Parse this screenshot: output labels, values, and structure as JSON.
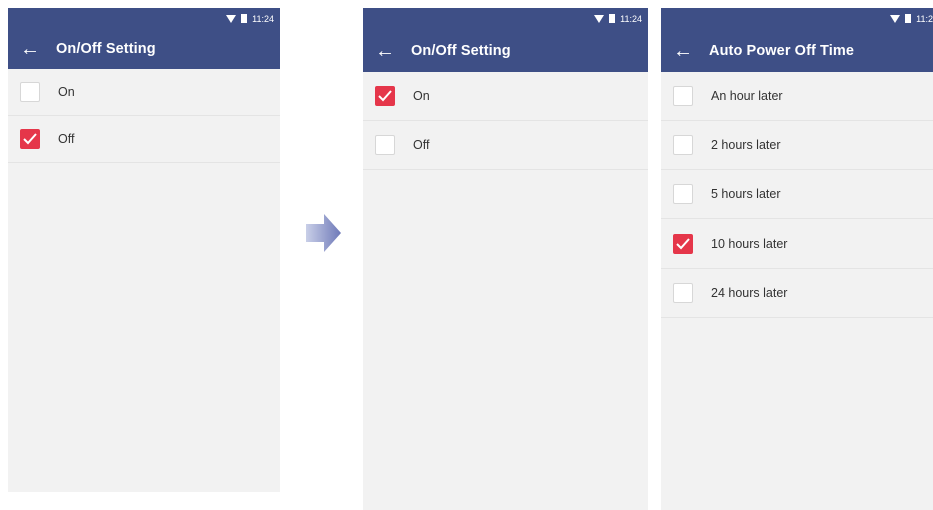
{
  "status": {
    "time": "11:24",
    "time_clipped": "11:2"
  },
  "screens": [
    {
      "title": "On/Off Setting",
      "items": [
        {
          "label": "On",
          "checked": false
        },
        {
          "label": "Off",
          "checked": true
        }
      ]
    },
    {
      "title": "On/Off Setting",
      "items": [
        {
          "label": "On",
          "checked": true
        },
        {
          "label": "Off",
          "checked": false
        }
      ]
    },
    {
      "title": "Auto Power Off Time",
      "items": [
        {
          "label": "An hour later",
          "checked": false
        },
        {
          "label": "2 hours later",
          "checked": false
        },
        {
          "label": "5 hours later",
          "checked": false
        },
        {
          "label": "10 hours later",
          "checked": true
        },
        {
          "label": "24 hours later",
          "checked": false
        }
      ]
    }
  ],
  "colors": {
    "appbar": "#3e4f86",
    "checked": "#e5364a",
    "arrow": "#8a94c8"
  },
  "icons": {
    "back": "back-arrow-icon",
    "wifi": "wifi-icon",
    "battery": "battery-icon",
    "transition": "right-arrow-icon"
  }
}
